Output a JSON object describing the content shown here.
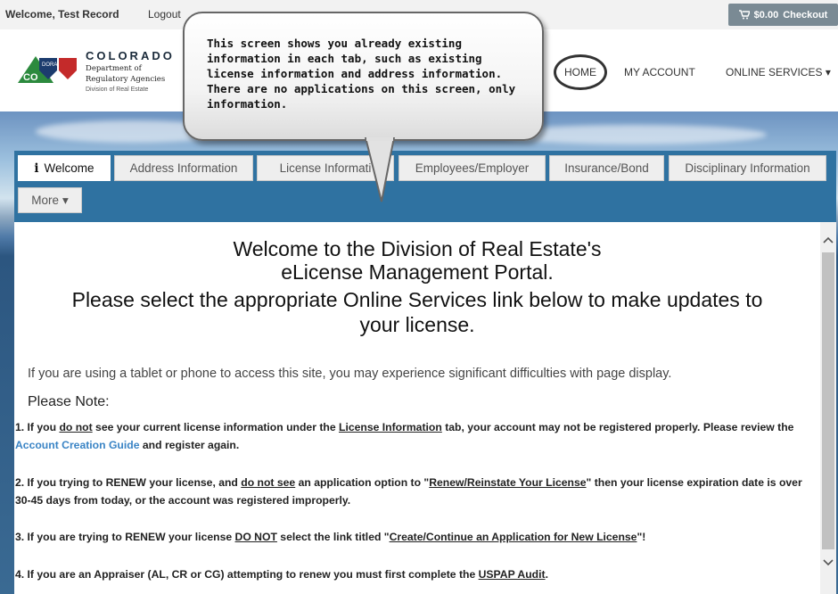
{
  "topbar": {
    "welcome_prefix": "Welcome,",
    "user_name": "Test Record",
    "logout": "Logout",
    "cart_total": "$0.00",
    "checkout": "Checkout"
  },
  "brand": {
    "state": "COLORADO",
    "dept_line1": "Department of",
    "dept_line2": "Regulatory Agencies",
    "division": "Division of Real Estate",
    "logo_text1": "DORA",
    "logo_text2": "CO"
  },
  "nav": {
    "home": "HOME",
    "my_account": "MY ACCOUNT",
    "online_services": "ONLINE SERVICES",
    "caret": "▾"
  },
  "callout": {
    "text": "This screen shows you already existing information in each tab, such as existing license information and address information. There are no applications on this screen, only information."
  },
  "tabs": [
    {
      "icon": "i",
      "label": "Welcome"
    },
    {
      "label": "Address Information"
    },
    {
      "label": "License Informati"
    },
    {
      "label": "Employees/Employer"
    },
    {
      "label": "Insurance/Bond"
    },
    {
      "label": "Disciplinary Information"
    },
    {
      "label": "More",
      "caret": "▾"
    }
  ],
  "content": {
    "heading_line1": "Welcome to the Division of Real Estate's",
    "heading_line2": "eLicense Management Portal.",
    "heading_line3": "Please select the appropriate Online Services link below to make updates to",
    "heading_line4": "your license.",
    "tablet_notice": "If you are using a tablet or phone to access this site, you may experience significant difficulties with page display.",
    "please_note": "Please Note:",
    "item1": {
      "p1": "1. If you ",
      "u1": "do not",
      "p2": " see your current license information under the ",
      "u2": "License Information",
      "p3": " tab, your account may not be registered properly. Please review the ",
      "link": "Account Creation Guide",
      "p4": " and register again."
    },
    "item2": {
      "p1": "2. If you trying to RENEW your license, and ",
      "u1": "do not see",
      "p2": " an application option to \"",
      "u2": "Renew/Reinstate Your License",
      "p3": "\" then your license expiration date is over 30-45 days from today, or the account was registered improperly."
    },
    "item3": {
      "p1": "3. If you are trying to RENEW your license ",
      "u1": "DO NOT",
      "p2": " select the link titled \"",
      "u2": "Create/Continue an Application for New License",
      "p3": "\"!"
    },
    "item4": {
      "p1": "4. If you are an Appraiser (AL, CR or CG) attempting to renew you must first complete the ",
      "u1": "USPAP Audit",
      "p2": "."
    }
  },
  "colors": {
    "tab_bar": "#2f72a1",
    "link": "#3a84c5",
    "checkout_bg": "#7a8a94"
  }
}
